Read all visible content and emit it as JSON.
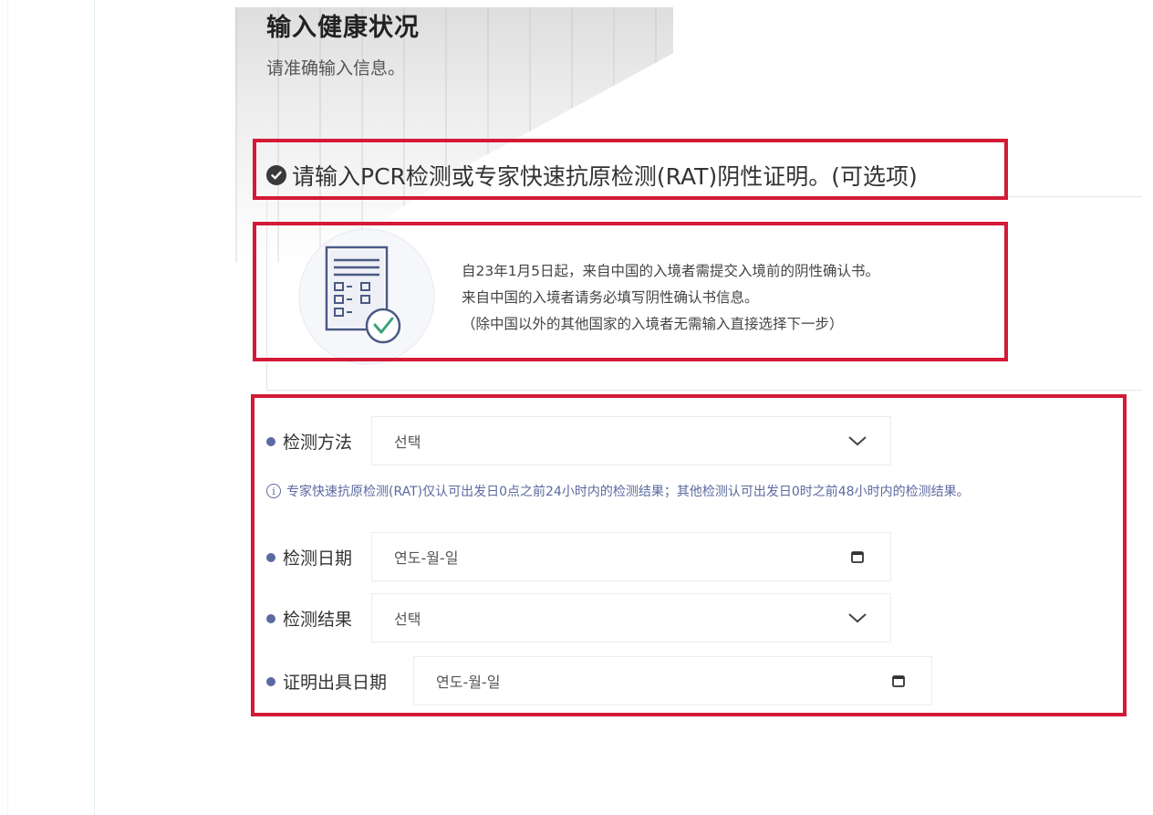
{
  "header": {
    "title": "输入健康状况",
    "subtitle": "请准确输入信息。"
  },
  "section": {
    "title": "请输入PCR检测或专家快速抗原检测(RAT)阴性证明。(可选项)",
    "check_icon": "check-circle-icon"
  },
  "notice": {
    "illustration_icon": "checklist-document-icon",
    "lines": [
      "自23年1月5日起，来自中国的入境者需提交入境前的阴性确认书。",
      "来自中国的入境者请务必填写阴性确认书信息。",
      "（除中国以外的其他国家的入境者无需输入直接选择下一步）"
    ]
  },
  "form": {
    "method": {
      "label": "检测方法",
      "value": "선택",
      "icon": "chevron-down-icon"
    },
    "hint": "专家快速抗原检测(RAT)仅认可出发日0点之前24小时内的检测结果；其他检测认可出发日0时之前48小时内的检测结果。",
    "test_date": {
      "label": "检测日期",
      "placeholder": "연도-월-일",
      "icon": "calendar-icon"
    },
    "result": {
      "label": "检测结果",
      "value": "선택",
      "icon": "chevron-down-icon"
    },
    "cert_date": {
      "label": "证明出具日期",
      "placeholder": "연도-월-일",
      "icon": "calendar-icon"
    }
  },
  "colors": {
    "highlight_border": "#d31a36",
    "bullet": "#5b6aa0",
    "hint_text": "#5b6aa0"
  }
}
